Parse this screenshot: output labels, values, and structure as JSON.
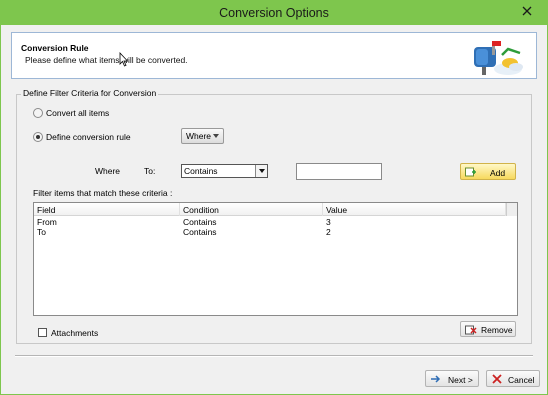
{
  "window": {
    "title": "Conversion Options"
  },
  "header": {
    "title": "Conversion Rule",
    "subtitle": "Please define what items will be converted."
  },
  "filter": {
    "group_label": "Define Filter Criteria for Conversion",
    "convert_all_label": "Convert all items",
    "convert_all_selected": false,
    "define_rule_label": "Define conversion rule",
    "define_rule_selected": true,
    "where_dropdown": "Where",
    "where_label": "Where",
    "to_label": "To:",
    "condition_select": "Contains",
    "value_input": "",
    "value_placeholder": "",
    "add_button": "Add"
  },
  "criteria": {
    "label": "Filter items that match these criteria :",
    "columns": [
      "Field",
      "Condition",
      "Value"
    ],
    "rows": [
      {
        "field": "From",
        "condition": "Contains",
        "value": "3"
      },
      {
        "field": "To",
        "condition": "Contains",
        "value": "2"
      }
    ]
  },
  "attachments": {
    "label": "Attachments",
    "checked": false
  },
  "remove_button": "Remove",
  "footer": {
    "next_button": "Next >",
    "cancel_button": "Cancel"
  },
  "colors": {
    "titlebar": "#7ec64d",
    "window_bg": "#f0f0f0",
    "header_border": "#9db7d6",
    "add_button": "#f7d95d"
  },
  "icons": {
    "window_close": "close-icon",
    "header": "mailbox-convert-icon",
    "add": "add-icon",
    "remove": "remove-icon",
    "next": "next-arrow-icon",
    "cancel": "cancel-x-icon"
  }
}
